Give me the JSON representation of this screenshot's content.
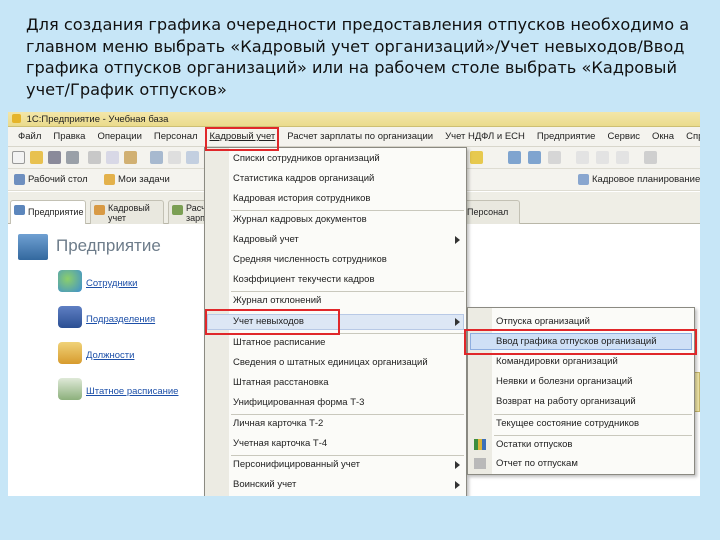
{
  "caption": "Для создания графика очередности предоставления отпусков необходимо а главном меню выбрать «Кадровый учет организаций»/Учет невыходов/Ввод графика отпусков организаций» или на рабочем столе выбрать «Кадровый учет/График отпусков»",
  "window": {
    "title": "1С:Предприятие - Учебная база"
  },
  "menubar": {
    "items": [
      "Файл",
      "Правка",
      "Операции",
      "Персонал",
      "Кадровый учет",
      "Расчет зарплаты по организации",
      "Учет НДФЛ и ЕСН",
      "Предприятие",
      "Сервис",
      "Окна",
      "Справка"
    ]
  },
  "toolbar2": {
    "items": [
      "Рабочий стол",
      "Мои задачи",
      "Кадровое планирование"
    ]
  },
  "tabs": [
    {
      "label": "Предприятие"
    },
    {
      "label": "Кадровый учет"
    },
    {
      "label": "Расчет зарп"
    },
    {
      "label": "Персонал"
    }
  ],
  "desktop": {
    "title": "Предприятие",
    "links": [
      "Сотрудники",
      "Подразделения",
      "Должности",
      "Штатное расписание"
    ]
  },
  "menu_kadr": {
    "items": [
      "Списки сотрудников организаций",
      "Статистика кадров организаций",
      "Кадровая история сотрудников",
      "Журнал кадровых документов",
      "Кадровый учет",
      "Средняя численность сотрудников",
      "Коэффициент текучести кадров",
      "Журнал отклонений",
      "Учет невыходов",
      "Штатное расписание",
      "Сведения о штатных единицах организаций",
      "Штатная расстановка",
      "Унифицированная форма Т-3",
      "Личная карточка Т-2",
      "Учетная карточка Т-4",
      "Персонифицированный учет",
      "Воинский учет"
    ]
  },
  "menu_nevyhody": {
    "items": [
      "Отпуска организаций",
      "Ввод графика отпусков организаций",
      "Командировки организаций",
      "Неявки и болезни организаций",
      "Возврат на работу организаций",
      "Текущее состояние сотрудников",
      "Остатки отпусков",
      "Отчет по отпускам"
    ]
  },
  "colors": {
    "highlight_box": "#e0272a",
    "link": "#1c4fa8",
    "slide_background": "#c7e6f7"
  }
}
